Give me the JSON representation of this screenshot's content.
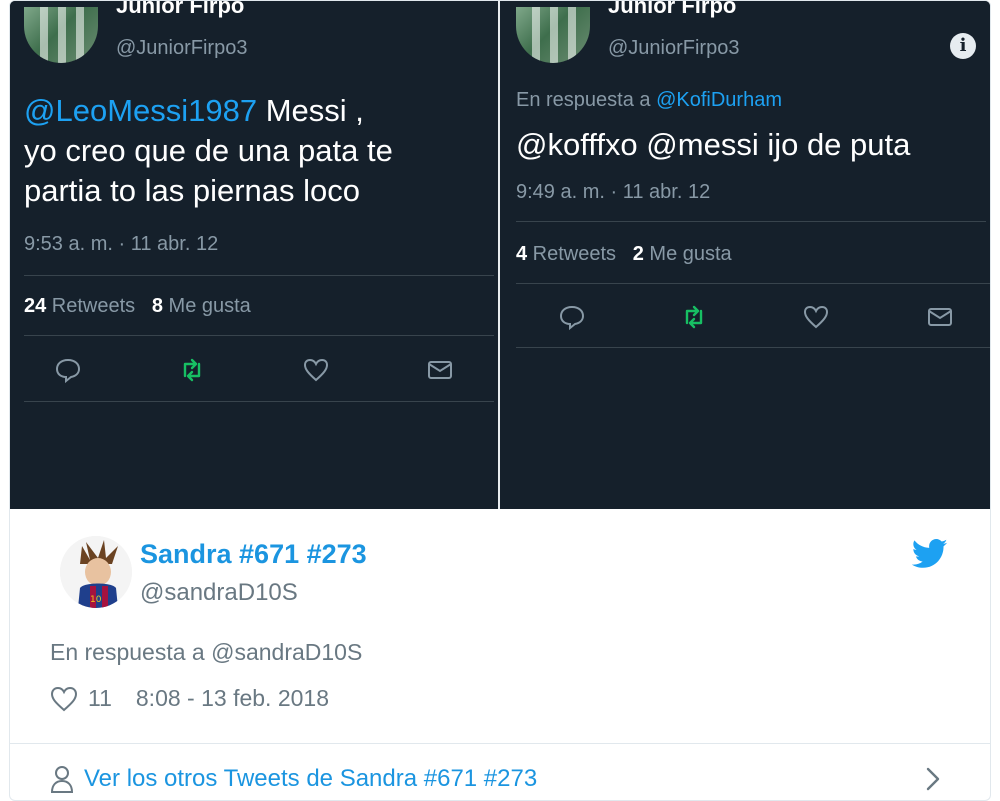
{
  "left_tweet": {
    "name": "Junior Firpo",
    "handle": "@JuniorFirpo3",
    "mention": "@LeoMessi1987",
    "text_line1": " Messi ,",
    "text_line2": "yo creo que de una pata te",
    "text_line3": "partia to las piernas loco",
    "time": "9:53 a. m. · 11 abr. 12",
    "retweets_count": "24",
    "retweets_label": " Retweets",
    "likes_count": "8",
    "likes_label": " Me gusta"
  },
  "right_tweet": {
    "name": "Junior Firpo",
    "handle": "@JuniorFirpo3",
    "reply_prefix": "En respuesta a ",
    "reply_mention": "@KofiDurham",
    "text": "@kofffxo @messi ijo de puta",
    "time": "9:49 a. m. · 11 abr. 12",
    "retweets_count": "4",
    "retweets_label": " Retweets",
    "likes_count": "2",
    "likes_label": " Me gusta"
  },
  "embed": {
    "name": "Sandra #671 #273",
    "handle": "@sandraD10S",
    "reply_text": "En respuesta a @sandraD10S",
    "likes": "11",
    "timestamp": "8:08 - 13 feb. 2018",
    "more_link": "Ver los otros Tweets de Sandra #671 #273"
  },
  "colors": {
    "dark_bg": "#15202b",
    "accent_blue": "#1da1f2",
    "retweet_green": "#17bf63",
    "muted": "#8899a6"
  },
  "icons": [
    "reply-icon",
    "retweet-icon",
    "like-icon",
    "dm-icon",
    "info-icon",
    "twitter-bird-icon",
    "heart-icon",
    "person-icon",
    "chevron-right-icon"
  ]
}
